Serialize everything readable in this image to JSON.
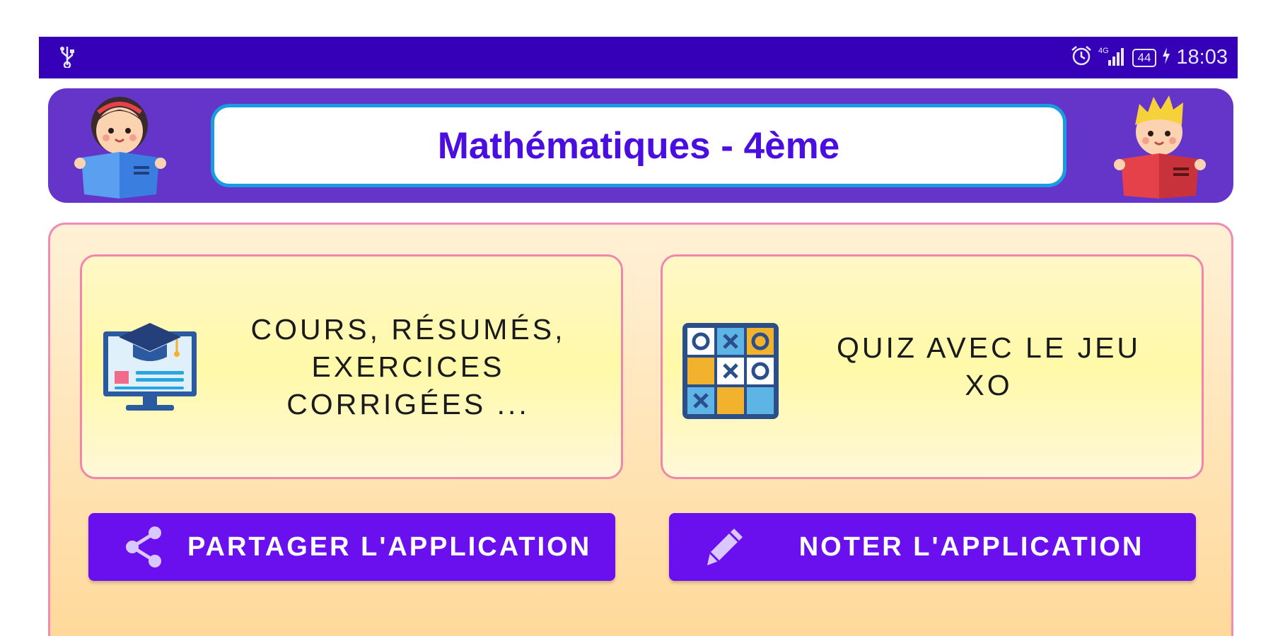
{
  "status_bar": {
    "time": "18:03",
    "battery": "44",
    "network": "4G",
    "icons": [
      "usb-icon",
      "alarm-icon",
      "signal-icon",
      "battery-icon",
      "charging-icon"
    ]
  },
  "header": {
    "title": "Mathématiques - 4ème",
    "left_avatar": "girl-reading-icon",
    "right_avatar": "boy-reading-icon"
  },
  "cards": [
    {
      "text_lines": [
        "COURS, RÉSUMÉS,",
        "EXERCICES",
        "CORRIGÉES ..."
      ],
      "icon": "graduation-computer-icon"
    },
    {
      "text_lines": [
        "QUIZ AVEC LE JEU",
        "XO"
      ],
      "icon": "tic-tac-toe-icon"
    }
  ],
  "buttons": {
    "share": {
      "label": "PARTAGER L'APPLICATION",
      "icon": "share-icon"
    },
    "rate": {
      "label": "NOTER L'APPLICATION",
      "icon": "pencil-icon"
    }
  },
  "colors": {
    "status_bar": "#3500b8",
    "header": "#6534c8",
    "title_text": "#4a0ee0",
    "title_border": "#1a9ce0",
    "button": "#6a10ee",
    "card_border": "#f086ad"
  }
}
